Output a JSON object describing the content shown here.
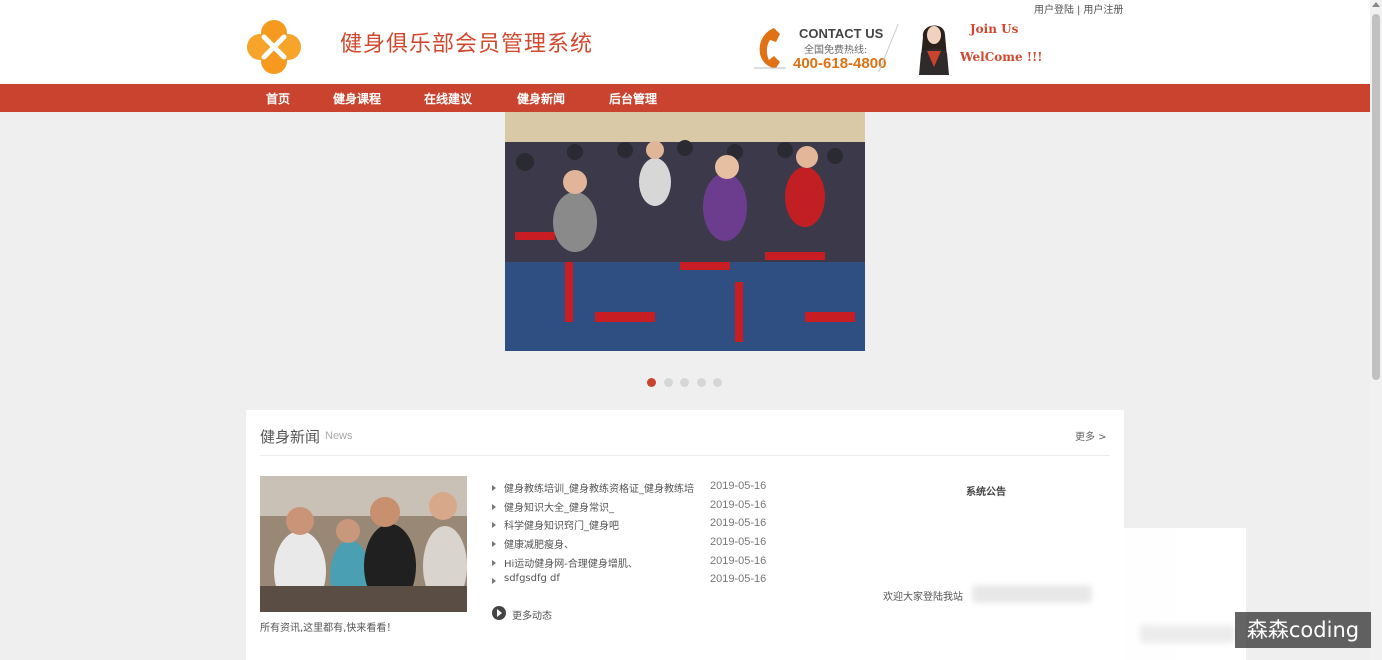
{
  "top_links": {
    "login": "用户登陆",
    "separator": "|",
    "register": "用户注册"
  },
  "site": {
    "title": "健身俱乐部会员管理系统"
  },
  "contact": {
    "label": "CONTACT US",
    "hotline_label": "全国免费热线:",
    "phone": "400-618-4800",
    "join": "Join Us",
    "welcome": "WelCome !!!"
  },
  "nav": {
    "items": [
      {
        "label": "首页"
      },
      {
        "label": "健身课程"
      },
      {
        "label": "在线建议"
      },
      {
        "label": "健身新闻"
      },
      {
        "label": "后台管理"
      }
    ]
  },
  "carousel": {
    "slide_count": 5,
    "active_index": 0
  },
  "news": {
    "title": "健身新闻",
    "subtitle": "News",
    "more": "更多 >",
    "caption": "所有资讯,这里都有,快来看看！",
    "items": [
      {
        "title": "健身教练培训_健身教练资格证_健身教练培",
        "date": "2019-05-16"
      },
      {
        "title": "健身知识大全_健身常识_",
        "date": "2019-05-16"
      },
      {
        "title": "科学健身知识窍门_健身吧",
        "date": "2019-05-16"
      },
      {
        "title": "健康减肥瘦身、",
        "date": "2019-05-16"
      },
      {
        "title": "Hi运动健身网-合理健身增肌、",
        "date": "2019-05-16"
      },
      {
        "title": "sdfgsdfg df",
        "date": "2019-05-16"
      }
    ],
    "more_news": "更多动态"
  },
  "notice": {
    "title": "系统公告",
    "text": "欢迎大家登陆我站"
  },
  "watermark": "森森coding",
  "colors": {
    "brand_red": "#c9432e",
    "title_red": "#d0492f",
    "phone_orange": "#e07215"
  }
}
